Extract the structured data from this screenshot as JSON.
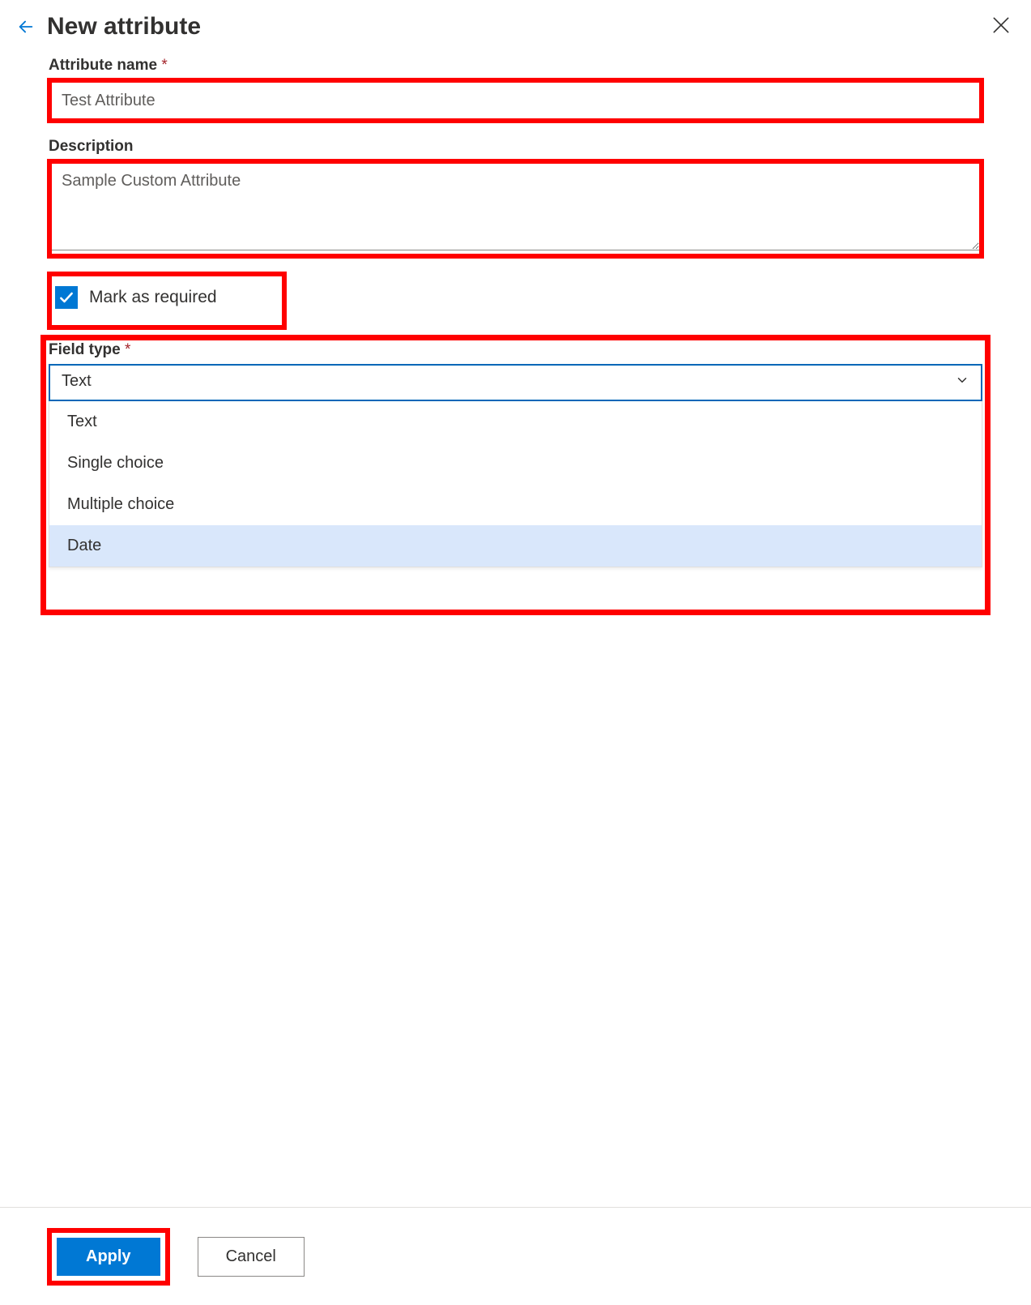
{
  "header": {
    "title": "New attribute"
  },
  "attribute_name": {
    "label": "Attribute name",
    "required": true,
    "value": "Test Attribute"
  },
  "description": {
    "label": "Description",
    "value": "Sample Custom Attribute"
  },
  "mark_required": {
    "label": "Mark as required",
    "checked": true
  },
  "field_type": {
    "label": "Field type",
    "required": true,
    "selected": "Text",
    "options": [
      "Text",
      "Single choice",
      "Multiple choice",
      "Date"
    ],
    "highlighted_option_index": 3
  },
  "footer": {
    "apply": "Apply",
    "cancel": "Cancel"
  }
}
